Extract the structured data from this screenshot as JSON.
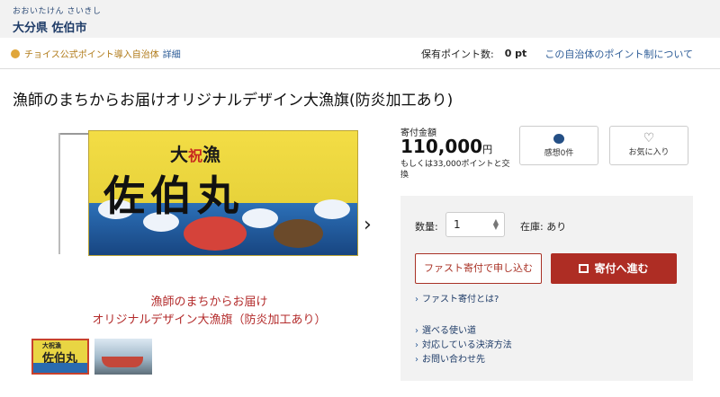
{
  "header": {
    "reading": "おおいたけん さいきし",
    "municipality": "大分県 佐伯市"
  },
  "point_bar": {
    "official_label": "チョイス公式ポイント導入自治体",
    "detail_link": "詳細",
    "holding_label": "保有ポイント数:",
    "holding_value": "0 pt",
    "about_link": "この自治体のポイント制について"
  },
  "product": {
    "title": "漁師のまちからお届けオリジナルデザイン大漁旗(防炎加工あり)",
    "image_caption_1": "漁師のまちからお届け",
    "image_caption_2": "オリジナルデザイン大漁旗（防炎加工あり）",
    "flag_top_text": "大",
    "flag_top_red": "祝",
    "flag_top_text2": "漁",
    "flag_main_text": "佐伯丸",
    "thumb_text_1": "大祝漁",
    "thumb_text_2": "佐伯丸",
    "next_arrow": "›"
  },
  "donation": {
    "label": "寄付金額",
    "amount": "110,000",
    "currency": "円",
    "alt_points": "もしくは33,000ポイントと交換"
  },
  "actions": {
    "impressions_label": "感想0件",
    "favorite_label": "お気に入り",
    "heart_icon": "♡",
    "quantity_label": "数量:",
    "quantity_value": "1",
    "stock_label": "在庫: あり",
    "fast_apply_button": "ファスト寄付で申し込む",
    "donate_button": "寄付へ進む",
    "links": [
      "ファスト寄付とは?",
      "選べる使い道",
      "対応している決済方法",
      "お問い合わせ先"
    ]
  }
}
